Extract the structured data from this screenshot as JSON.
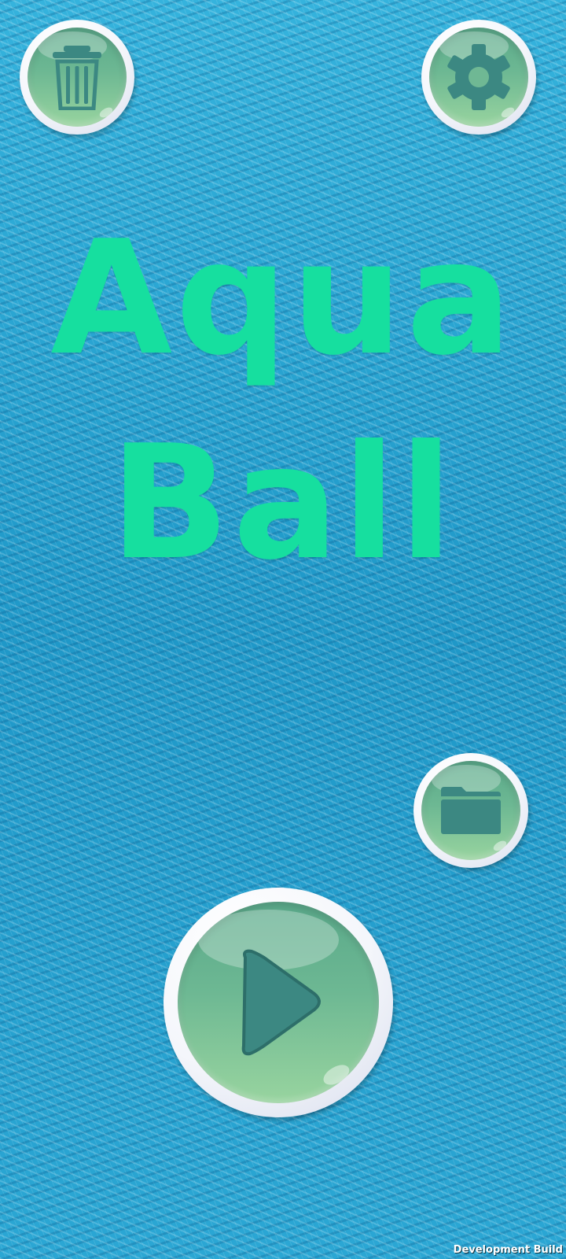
{
  "title": {
    "line1": "Aqua",
    "line2": "Ball"
  },
  "buttons": {
    "trash": {
      "icon": "trash-icon"
    },
    "settings": {
      "icon": "gear-icon"
    },
    "folder": {
      "icon": "folder-icon"
    },
    "play": {
      "icon": "play-icon"
    }
  },
  "footer": {
    "build_label": "Development Build"
  },
  "colors": {
    "title": "#16df9f",
    "button_face": "#6db893",
    "icon": "#3c8882",
    "water": "#2aa3cf"
  }
}
